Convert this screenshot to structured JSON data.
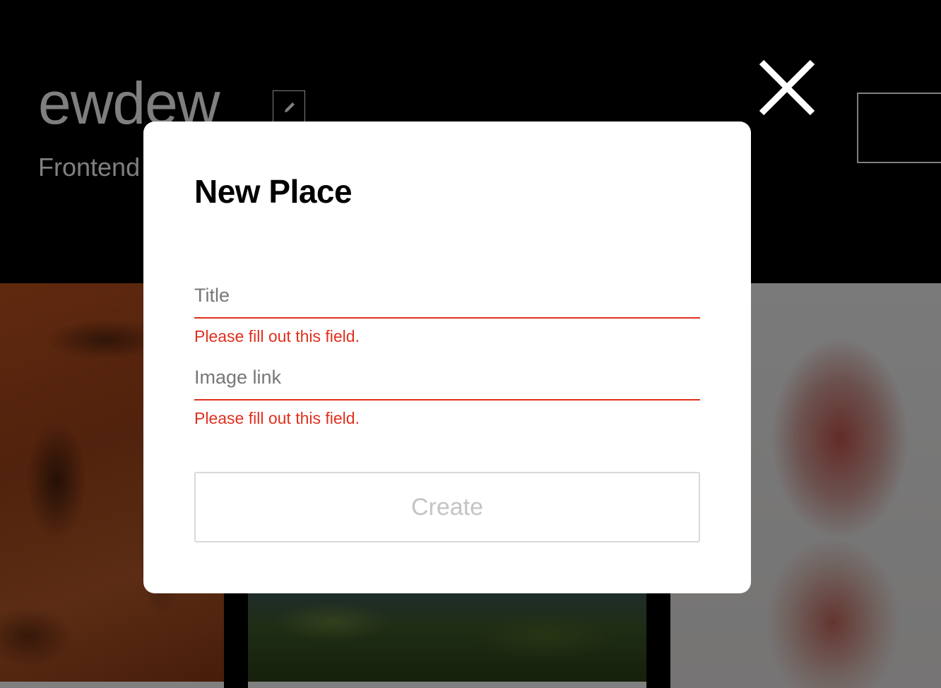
{
  "profile": {
    "name": "ewdew",
    "job": "Frontend"
  },
  "popup": {
    "title": "New Place",
    "title_field": {
      "placeholder": "Title",
      "value": "",
      "error": "Please fill out this field."
    },
    "link_field": {
      "placeholder": "Image link",
      "value": "",
      "error": "Please fill out this field."
    },
    "submit_label": "Create",
    "submit_enabled": false
  },
  "colors": {
    "page_background": "#000000",
    "overlay": "rgba(0,0,0,0.5)",
    "error": "#e0301e",
    "disabled_text": "#c4c4c4",
    "disabled_border": "#d9d9d9"
  },
  "icons": {
    "close": "close-icon",
    "edit": "pencil-icon"
  }
}
